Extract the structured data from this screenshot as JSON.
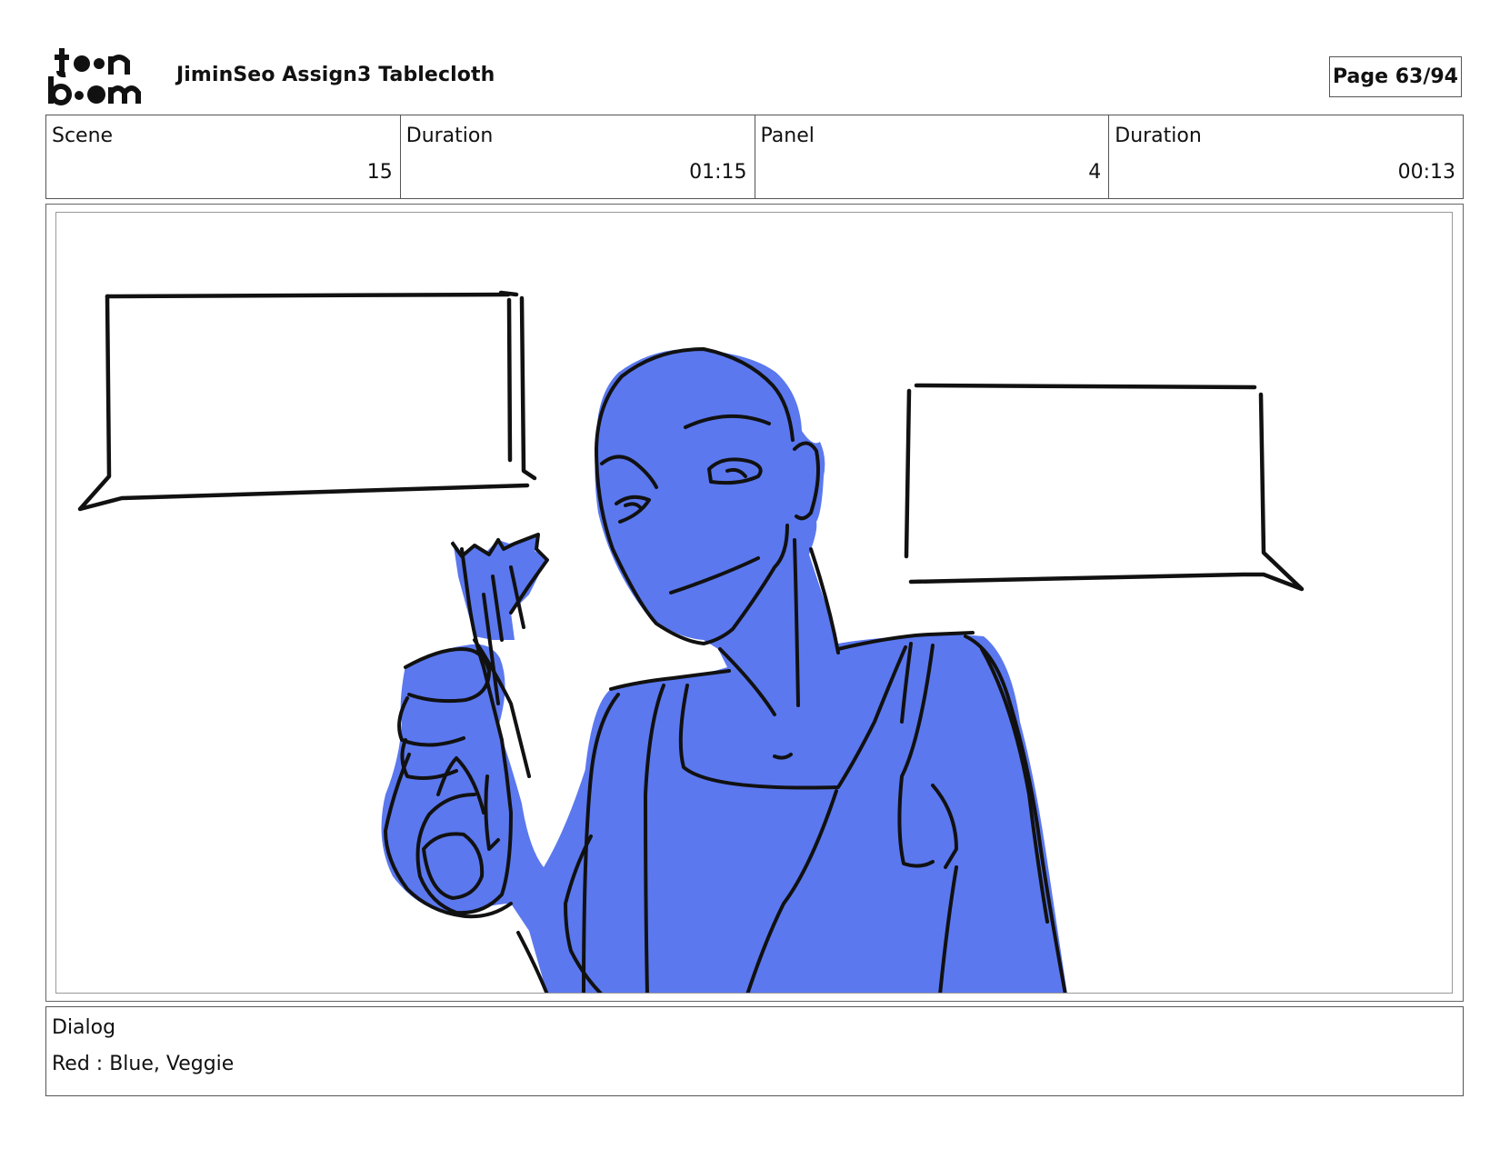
{
  "header": {
    "logo_text": "toon boom",
    "title": "JiminSeo Assign3 Tablecloth",
    "page": "Page 63/94"
  },
  "info": {
    "scene_label": "Scene",
    "scene_value": "15",
    "scene_duration_label": "Duration",
    "scene_duration_value": "01:15",
    "panel_label": "Panel",
    "panel_value": "4",
    "panel_duration_label": "Duration",
    "panel_duration_value": "00:13"
  },
  "dialog": {
    "label": "Dialog",
    "text": "Red : Blue, Veggie"
  },
  "colors": {
    "character_fill": "#5b78ef",
    "line": "#111111"
  },
  "icons": {
    "logo": "toon-boom-logo"
  }
}
